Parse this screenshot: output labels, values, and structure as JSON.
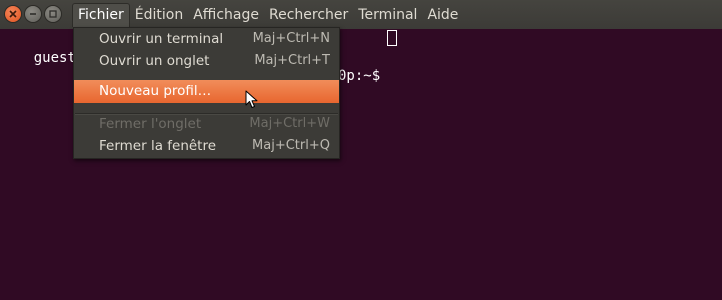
{
  "window": {
    "controls": [
      "close-icon",
      "minimize-icon",
      "maximize-icon"
    ]
  },
  "menubar": {
    "items": [
      {
        "label": "Fichier",
        "active": true
      },
      {
        "label": "Édition"
      },
      {
        "label": "Affichage"
      },
      {
        "label": "Rechercher"
      },
      {
        "label": "Terminal"
      },
      {
        "label": "Aide"
      }
    ]
  },
  "terminal": {
    "prompt_start": "guest-Vo",
    "prompt_end": "0p:~$",
    "cursor_icon": "block-cursor"
  },
  "menu": {
    "items": [
      {
        "label": "Ouvrir un terminal",
        "shortcut": "Maj+Ctrl+N",
        "state": "normal"
      },
      {
        "label": "Ouvrir un onglet",
        "shortcut": "Maj+Ctrl+T",
        "state": "normal"
      },
      {
        "label": "Nouveau profil…",
        "shortcut": "",
        "state": "highlighted"
      },
      {
        "label": "Fermer l'onglet",
        "shortcut": "Maj+Ctrl+W",
        "state": "disabled"
      },
      {
        "label": "Fermer la fenêtre",
        "shortcut": "Maj+Ctrl+Q",
        "state": "normal"
      }
    ]
  },
  "colors": {
    "terminal_bg": "#300a24",
    "menubar_bg": "#3c3b37",
    "highlight": "#f07746",
    "close_button": "#e95420"
  },
  "pointer_icon": "arrow-cursor-icon"
}
